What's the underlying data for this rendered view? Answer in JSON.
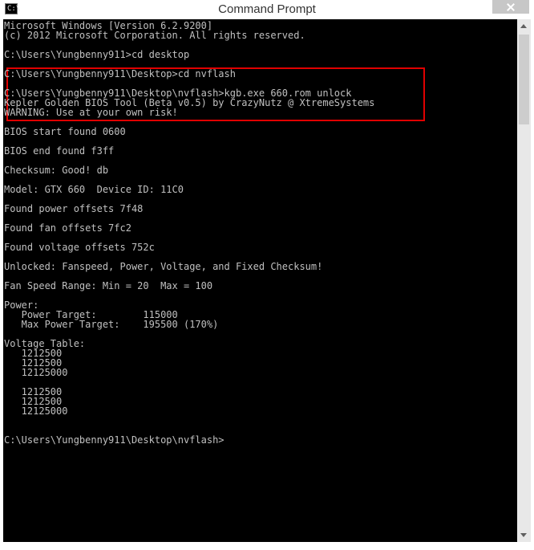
{
  "window": {
    "title": "Command Prompt",
    "icon_label": "C:\\"
  },
  "console": {
    "lines": [
      "Microsoft Windows [Version 6.2.9200]",
      "(c) 2012 Microsoft Corporation. All rights reserved.",
      "",
      "C:\\Users\\Yungbenny911>cd desktop",
      "",
      "C:\\Users\\Yungbenny911\\Desktop>cd nvflash",
      "",
      "C:\\Users\\Yungbenny911\\Desktop\\nvflash>kgb.exe 660.rom unlock",
      "Kepler Golden BIOS Tool (Beta v0.5) by CrazyNutz @ XtremeSystems",
      "WARNING: Use at your own risk!",
      "",
      "BIOS start found 0600",
      "",
      "BIOS end found f3ff",
      "",
      "Checksum: Good! db",
      "",
      "Model: GTX 660  Device ID: 11C0",
      "",
      "Found power offsets 7f48",
      "",
      "Found fan offsets 7fc2",
      "",
      "Found voltage offsets 752c",
      "",
      "Unlocked: Fanspeed, Power, Voltage, and Fixed Checksum!",
      "",
      "Fan Speed Range: Min = 20  Max = 100",
      "",
      "Power:",
      "   Power Target:        115000",
      "   Max Power Target:    195500 (170%)",
      "",
      "Voltage Table:",
      "   1212500",
      "   1212500",
      "   12125000",
      "",
      "   1212500",
      "   1212500",
      "   12125000",
      "",
      "",
      "C:\\Users\\Yungbenny911\\Desktop\\nvflash>"
    ]
  },
  "colors": {
    "console_bg": "#000000",
    "console_text": "#c0c0c0",
    "highlight_border": "#e00000"
  }
}
